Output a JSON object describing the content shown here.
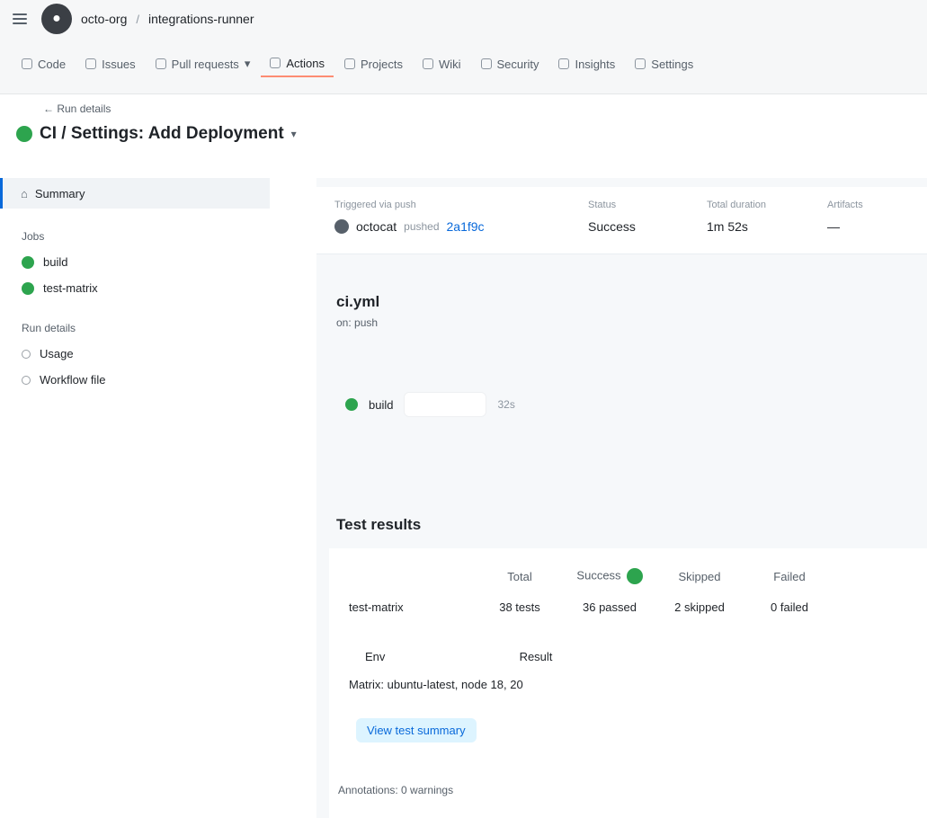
{
  "header": {
    "logo_icon": "repo-icon",
    "breadcrumb_owner": "octo-org",
    "breadcrumb_separator": "/",
    "breadcrumb_repo": "integrations-runner"
  },
  "nav": {
    "tabs": [
      {
        "label": "Code"
      },
      {
        "label": "Issues"
      },
      {
        "label": "Pull requests"
      },
      {
        "label": "Actions"
      },
      {
        "label": "Projects"
      },
      {
        "label": "Wiki"
      },
      {
        "label": "Security"
      },
      {
        "label": "Insights"
      },
      {
        "label": "Settings"
      }
    ],
    "active_index": 3
  },
  "run": {
    "back_label": "Run details",
    "title": "CI / Settings: Add Deployment",
    "status": "success"
  },
  "sidebar": {
    "summary_label": "Summary",
    "jobs_group": "Jobs",
    "jobs": [
      {
        "label": "build"
      },
      {
        "label": "test-matrix"
      }
    ],
    "run_details_group": "Run details",
    "details": [
      {
        "label": "Usage"
      },
      {
        "label": "Workflow file"
      }
    ]
  },
  "status_card": {
    "trigger_label": "Triggered via push",
    "actor": "octocat",
    "pushed_label": "pushed",
    "sha": "2a1f9c",
    "status_label": "Status",
    "status_value": "Success",
    "duration_label": "Total duration",
    "duration_value": "1m 52s",
    "artifacts_label": "Artifacts",
    "artifacts_value": "—"
  },
  "workflow": {
    "title": "ci.yml",
    "subtitle": "on: push",
    "job_label": "build",
    "job_time": "32s"
  },
  "metrics": {
    "title": "Test results",
    "headers": [
      "",
      "Total",
      "Success",
      "Skipped",
      "Failed"
    ],
    "row_label": "test-matrix",
    "row_values": [
      "38 tests",
      "36 passed",
      "2 skipped",
      "0 failed"
    ],
    "extra_headers": [
      "Env",
      "Result"
    ],
    "note": "Matrix: ubuntu-latest, node 18, 20",
    "link_label": "View test summary",
    "footer": "Annotations: 0 warnings"
  }
}
